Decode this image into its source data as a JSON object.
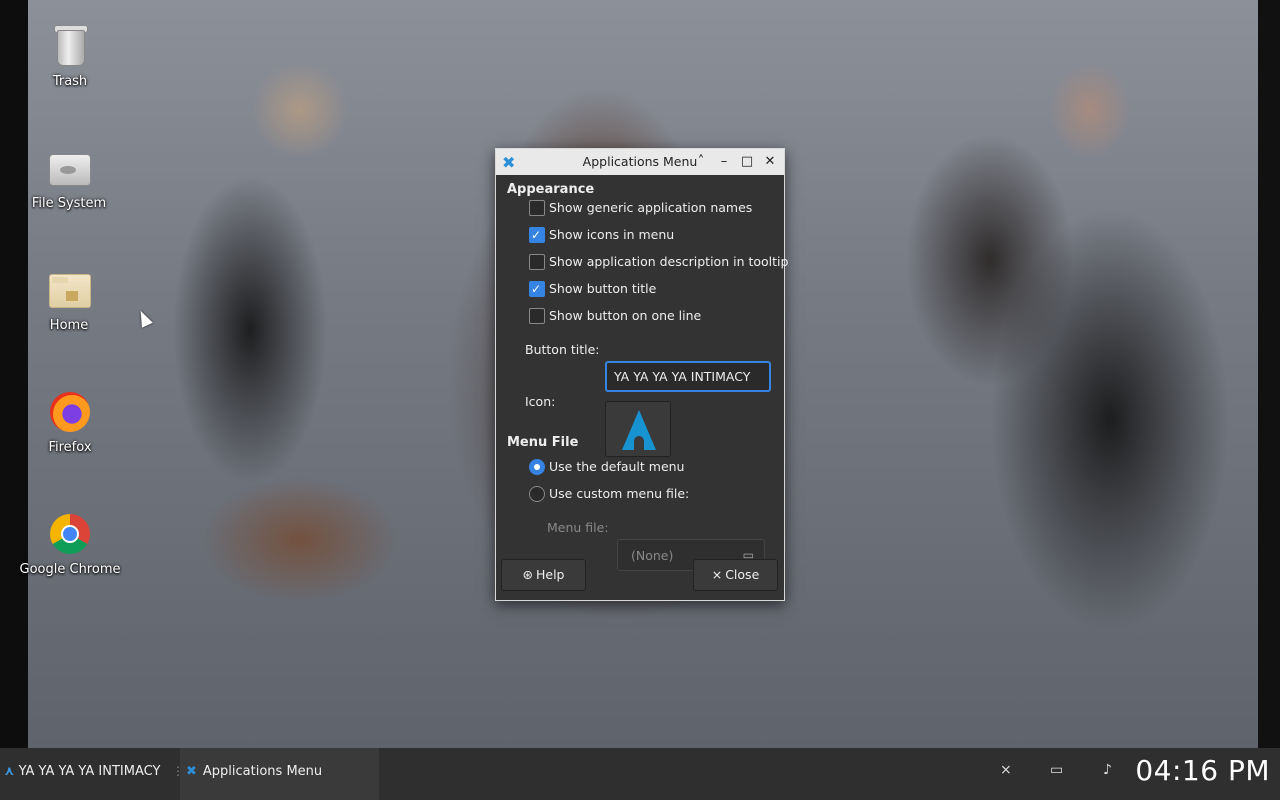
{
  "desktop": {
    "icons": [
      {
        "label": "Trash",
        "icon": "trash-icon"
      },
      {
        "label": "File System",
        "icon": "drive-icon"
      },
      {
        "label": "Home",
        "icon": "home-folder-icon"
      },
      {
        "label": "Firefox",
        "icon": "firefox-icon"
      },
      {
        "label": "Google Chrome",
        "icon": "chrome-icon"
      }
    ]
  },
  "dialog": {
    "title": "Applications Menu",
    "appearance": {
      "heading": "Appearance",
      "options": [
        {
          "label": "Show generic application names",
          "checked": false
        },
        {
          "label": "Show icons in menu",
          "checked": true
        },
        {
          "label": "Show application description in tooltip",
          "checked": false
        },
        {
          "label": "Show button title",
          "checked": true
        },
        {
          "label": "Show button on one line",
          "checked": false
        }
      ],
      "button_title_label": "Button title:",
      "button_title_value": "YA YA YA YA INTIMACY",
      "icon_label": "Icon:"
    },
    "menu_file": {
      "heading": "Menu File",
      "options": [
        {
          "label": "Use the default menu",
          "selected": true
        },
        {
          "label": "Use custom menu file:",
          "selected": false
        }
      ],
      "menu_file_label": "Menu file:",
      "menu_file_value": "(None)"
    },
    "help_label": "Help",
    "close_label": "Close"
  },
  "taskbar": {
    "menu_button_label": "YA YA YA YA INTIMACY",
    "task_label": "Applications Menu",
    "clock": "04:16 PM"
  },
  "colors": {
    "accent": "#3584e4",
    "arch_blue": "#1793d1",
    "panel_bg": "#2f2f2f",
    "dialog_bg": "#333333"
  }
}
